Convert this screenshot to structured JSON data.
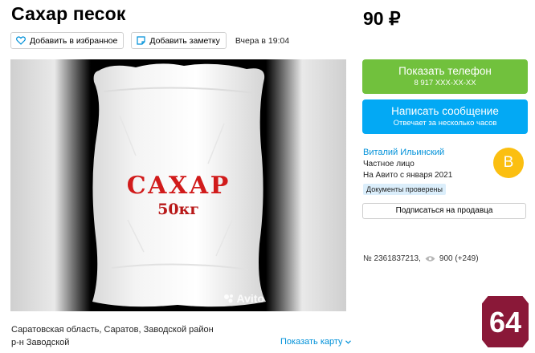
{
  "listing": {
    "title": "Сахар песок",
    "price": "90 ₽",
    "favorite_label": "Добавить в избранное",
    "note_label": "Добавить заметку",
    "date": "Вчера в 19:04"
  },
  "photo": {
    "bag_word": "САХАР",
    "bag_weight": "50кг",
    "watermark": "Avito"
  },
  "contact": {
    "phone_label": "Показать телефон",
    "phone_masked": "8 917 XXX-XX-XX",
    "message_label": "Написать сообщение",
    "message_sub": "Отвечает за несколько часов"
  },
  "seller": {
    "name": "Виталий Ильинский",
    "type": "Частное лицо",
    "since": "На Авито с января 2021",
    "badge": "Документы проверены",
    "avatar_letter": "В",
    "subscribe_label": "Подписаться на продавца"
  },
  "stats": {
    "item_id": "№ 2361837213,",
    "views": "900 (+249)"
  },
  "location": {
    "line1": "Саратовская область, Саратов, Заводской район",
    "line2": "р-н Заводской",
    "show_map": "Показать карту"
  },
  "overlay": {
    "logo_text": "64"
  },
  "colors": {
    "green": "#71c13d",
    "blue": "#03a9f4",
    "link": "#0091d9",
    "avatar": "#fbbf11",
    "logo": "#8a1838"
  },
  "icons": [
    "heart-icon",
    "note-icon",
    "eye-icon",
    "chevron-down-icon",
    "camera-icon"
  ]
}
